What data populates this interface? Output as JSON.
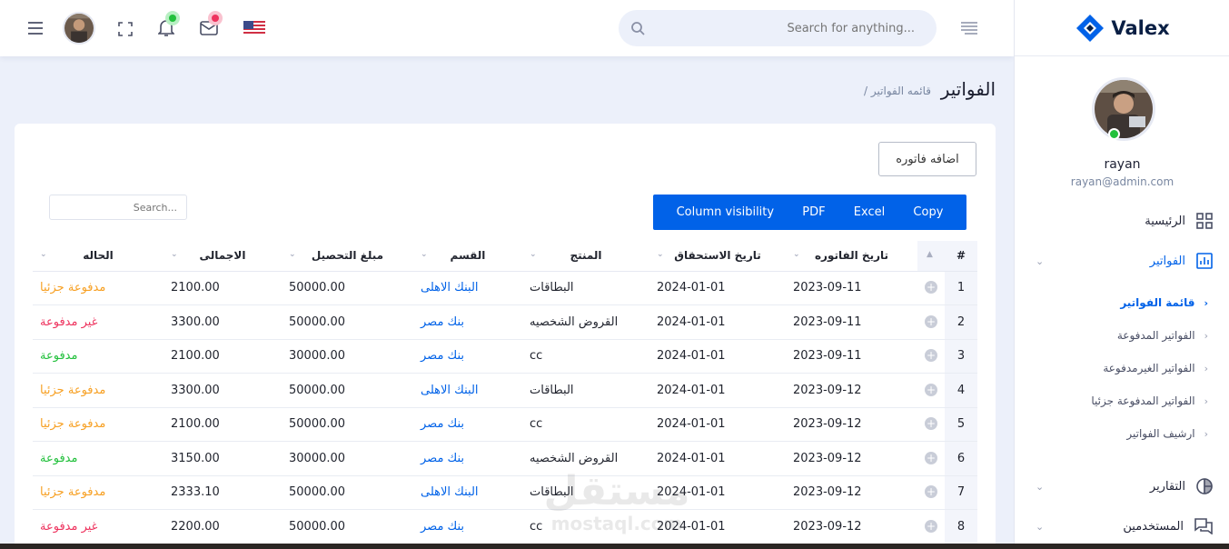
{
  "brand": {
    "name": "Valex",
    "color": "#0162e8"
  },
  "header": {
    "search_placeholder": "Search for anything..."
  },
  "user": {
    "name": "rayan",
    "email": "rayan@admin.com"
  },
  "sidebar": {
    "items": [
      {
        "label": "الرئيسية",
        "icon": "grid-icon"
      },
      {
        "label": "الفواتير",
        "icon": "chart-bar-icon"
      },
      {
        "label": "التقارير",
        "icon": "pie-chart-icon"
      },
      {
        "label": "المستخدمين",
        "icon": "chat-icon"
      }
    ],
    "sub_items": [
      {
        "label": "قائمة الفواتير"
      },
      {
        "label": "الفواتير المدفوعة"
      },
      {
        "label": "الفواتير الغيرمدفوعة"
      },
      {
        "label": "الفواتير المدفوعة جزئيا"
      },
      {
        "label": "ارشيف الفواتير"
      }
    ]
  },
  "page": {
    "title": "الفواتير",
    "breadcrumb": "/ قائمه الفواتير"
  },
  "toolbar": {
    "add_invoice": "اضافه فاتوره",
    "buttons": [
      "Copy",
      "Excel",
      "PDF",
      "Column visibility"
    ],
    "search_placeholder": "Search..."
  },
  "table": {
    "headers": [
      "#",
      "تاريخ الفاتوره",
      "تاريخ الاستحقاق",
      "المنتج",
      "القسم",
      "مبلغ التحصيل",
      "الاجمالى",
      "الحاله"
    ],
    "rows": [
      {
        "n": "1",
        "invoice_date": "2023-09-11",
        "due_date": "2024-01-01",
        "product": "البطاقات",
        "section": "البنك الاهلى",
        "collection": "50000.00",
        "total": "2100.00",
        "status": "مدفوعة جزئيا",
        "status_type": "part"
      },
      {
        "n": "2",
        "invoice_date": "2023-09-11",
        "due_date": "2024-01-01",
        "product": "القروض الشخصيه",
        "section": "بنك مصر",
        "collection": "50000.00",
        "total": "3300.00",
        "status": "غير مدفوعة",
        "status_type": "unpaid"
      },
      {
        "n": "3",
        "invoice_date": "2023-09-11",
        "due_date": "2024-01-01",
        "product": "cc",
        "section": "بنك مصر",
        "collection": "30000.00",
        "total": "2100.00",
        "status": "مدفوعة",
        "status_type": "paid"
      },
      {
        "n": "4",
        "invoice_date": "2023-09-12",
        "due_date": "2024-01-01",
        "product": "البطاقات",
        "section": "البنك الاهلى",
        "collection": "50000.00",
        "total": "3300.00",
        "status": "مدفوعة جزئيا",
        "status_type": "part"
      },
      {
        "n": "5",
        "invoice_date": "2023-09-12",
        "due_date": "2024-01-01",
        "product": "cc",
        "section": "بنك مصر",
        "collection": "50000.00",
        "total": "2100.00",
        "status": "مدفوعة جزئيا",
        "status_type": "part"
      },
      {
        "n": "6",
        "invoice_date": "2023-09-12",
        "due_date": "2024-01-01",
        "product": "القروض الشخصيه",
        "section": "بنك مصر",
        "collection": "30000.00",
        "total": "3150.00",
        "status": "مدفوعة",
        "status_type": "paid"
      },
      {
        "n": "7",
        "invoice_date": "2023-09-12",
        "due_date": "2024-01-01",
        "product": "البطاقات",
        "section": "البنك الاهلى",
        "collection": "50000.00",
        "total": "2333.10",
        "status": "مدفوعة جزئيا",
        "status_type": "part"
      },
      {
        "n": "8",
        "invoice_date": "2023-09-12",
        "due_date": "2024-01-01",
        "product": "cc",
        "section": "بنك مصر",
        "collection": "50000.00",
        "total": "2200.00",
        "status": "غير مدفوعة",
        "status_type": "unpaid"
      }
    ]
  },
  "watermark": {
    "text_ar": "مستقل",
    "text_en": "mostaql.com"
  },
  "colors": {
    "paid": "#22c03c",
    "partial": "#f7a023",
    "unpaid": "#ee335e",
    "primary": "#0162e8"
  }
}
